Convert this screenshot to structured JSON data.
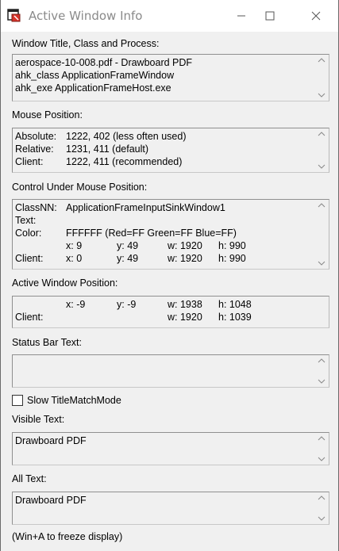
{
  "window": {
    "title": "Active Window Info",
    "controls": {
      "minimize": "minimize",
      "maximize": "maximize",
      "close": "close"
    }
  },
  "sections": {
    "window_title": {
      "label": "Window Title, Class and Process:",
      "lines": [
        "aerospace-10-008.pdf - Drawboard PDF",
        "ahk_class ApplicationFrameWindow",
        "ahk_exe ApplicationFrameHost.exe"
      ]
    },
    "mouse_position": {
      "label": "Mouse Position:",
      "rows": [
        {
          "key": "Absolute:",
          "value": "1222, 402 (less often used)"
        },
        {
          "key": "Relative:",
          "value": "1231, 411 (default)"
        },
        {
          "key": "Client:",
          "value": "1222, 411 (recommended)"
        }
      ]
    },
    "control": {
      "label": "Control Under Mouse Position:",
      "classnn_key": "ClassNN:",
      "classnn_value": "ApplicationFrameInputSinkWindow1",
      "text_key": "Text:",
      "color_key": "Color:",
      "color_value": "FFFFFF (Red=FF Green=FF Blue=FF)",
      "pos": {
        "x": "x: 9",
        "y": "y: 49",
        "w": "w: 1920",
        "h": "h: 990"
      },
      "client_key": "Client:",
      "client": {
        "x": "x: 0",
        "y": "y: 49",
        "w": "w: 1920",
        "h": "h: 990"
      }
    },
    "active_window": {
      "label": "Active Window Position:",
      "pos": {
        "x": "x: -9",
        "y": "y: -9",
        "w": "w: 1938",
        "h": "h: 1048"
      },
      "client_key": "Client:",
      "client": {
        "w": "w: 1920",
        "h": "h: 1039"
      }
    },
    "status_bar": {
      "label": "Status Bar Text:"
    },
    "slow_mode": {
      "label": "Slow TitleMatchMode",
      "checked": false
    },
    "visible_text": {
      "label": "Visible Text:",
      "value": "Drawboard PDF"
    },
    "all_text": {
      "label": "All Text:",
      "value": "Drawboard PDF"
    },
    "footer": "(Win+A to freeze display)"
  }
}
